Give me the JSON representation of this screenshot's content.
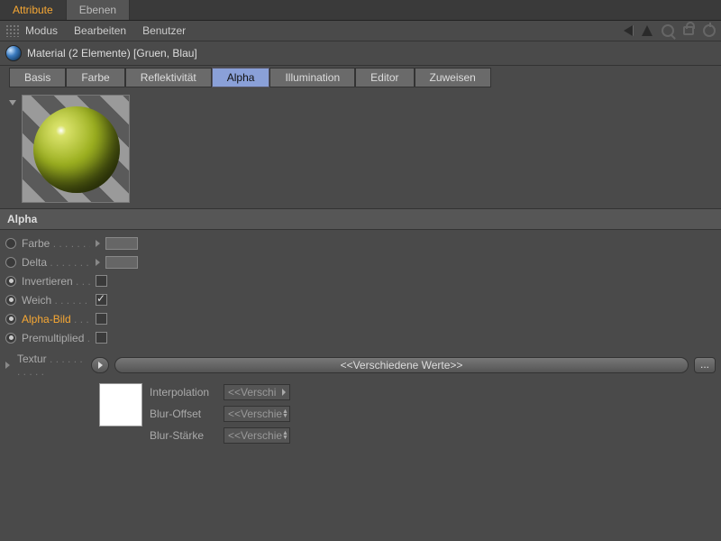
{
  "topTabs": {
    "active": "Attribute",
    "other": "Ebenen"
  },
  "menu": {
    "modus": "Modus",
    "bearbeiten": "Bearbeiten",
    "benutzer": "Benutzer"
  },
  "header": {
    "title": "Material (2 Elemente) [Gruen, Blau]"
  },
  "chanTabs": {
    "basis": "Basis",
    "farbe": "Farbe",
    "reflekt": "Reflektivität",
    "alpha": "Alpha",
    "illum": "Illumination",
    "editor": "Editor",
    "zuweisen": "Zuweisen"
  },
  "section": {
    "title": "Alpha"
  },
  "props": {
    "farbe": "Farbe",
    "delta": "Delta",
    "invertieren": "Invertieren",
    "weich": "Weich",
    "alphaBild": "Alpha-Bild",
    "premult": "Premultiplied",
    "textur": "Textur"
  },
  "states": {
    "invertieren": false,
    "weich": true,
    "alphaBild": false,
    "premult": false
  },
  "texture": {
    "barText": "<<Verschiedene Werte>>",
    "interpolation": {
      "label": "Interpolation",
      "value": "<<Verschi"
    },
    "blurOffset": {
      "label": "Blur-Offset",
      "value": "<<Verschie"
    },
    "blurStaerke": {
      "label": "Blur-Stärke",
      "value": "<<Verschie"
    },
    "ellipsis": "..."
  }
}
